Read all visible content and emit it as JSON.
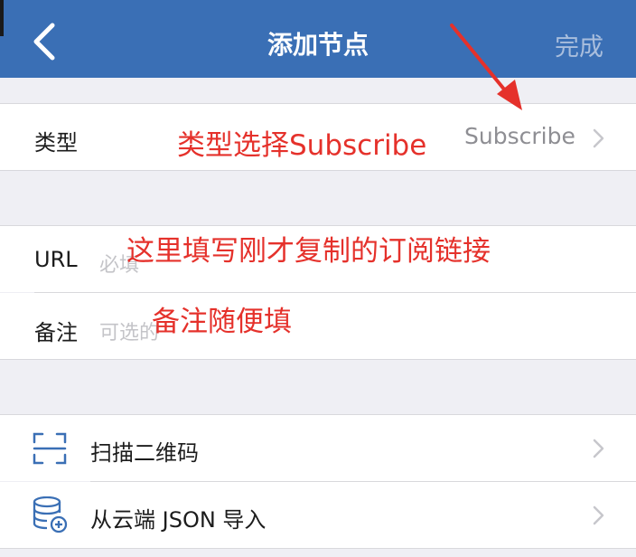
{
  "nav": {
    "title": "添加节点",
    "done_label": "完成",
    "back_icon": "chevron-left-icon",
    "background": "#3a6fb5"
  },
  "type_row": {
    "label": "类型",
    "value": "Subscribe"
  },
  "url_row": {
    "label": "URL",
    "placeholder": "必填"
  },
  "remark_row": {
    "label": "备注",
    "placeholder": "可选的"
  },
  "actions": [
    {
      "label": "扫描二维码",
      "icon": "qr-scan-icon"
    },
    {
      "label": "从云端 JSON 导入",
      "icon": "database-add-icon"
    }
  ],
  "annotations": {
    "type_hint": "类型选择Subscribe",
    "url_hint": "这里填写刚才复制的订阅链接",
    "remark_hint": "备注随便填",
    "color": "#e5312b"
  }
}
